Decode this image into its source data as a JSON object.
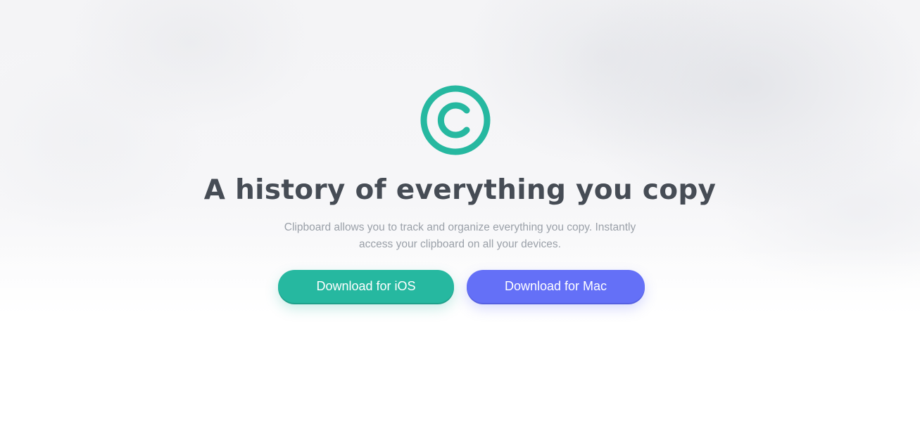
{
  "hero": {
    "logo_icon": "copyright-clipboard-icon",
    "accent_color": "#26b8a0",
    "headline": "A history of everything you copy",
    "subtitle_line1": "Clipboard allows you to track and organize everything you copy. Instantly",
    "subtitle_line2": "access your clipboard on all your devices."
  },
  "buttons": {
    "ios_label": "Download for iOS",
    "ios_color": "#26b8a0",
    "mac_label": "Download for Mac",
    "mac_color": "#6470f7"
  }
}
